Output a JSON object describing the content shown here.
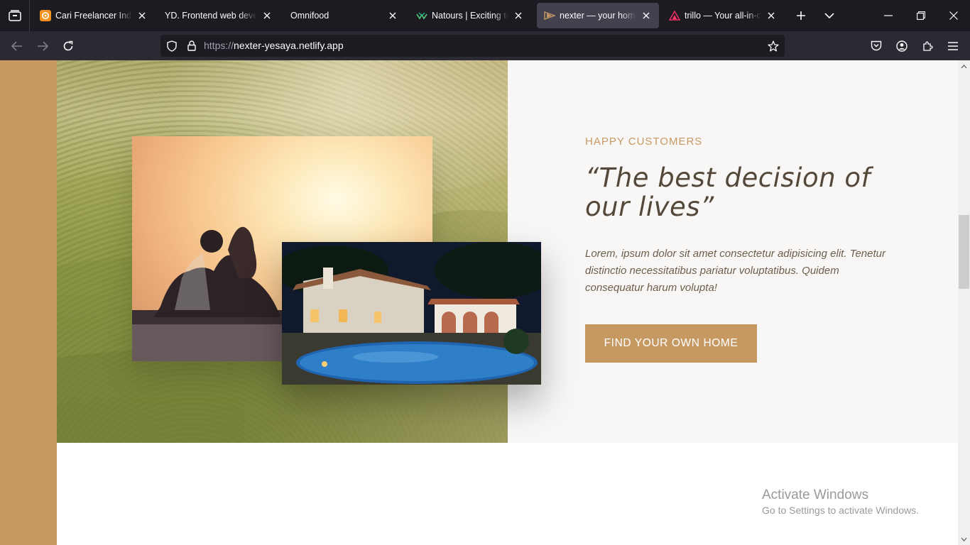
{
  "browser": {
    "tabs": [
      {
        "title": "Cari Freelancer Indonesia",
        "favicon": "orange-spiral-icon",
        "active": false
      },
      {
        "title": "YD. Frontend web developer",
        "favicon": "none",
        "active": false
      },
      {
        "title": "Omnifood",
        "favicon": "none",
        "active": false
      },
      {
        "title": "Natours | Exciting tours",
        "favicon": "natours-logo-icon",
        "active": false
      },
      {
        "title": "nexter — your home, your",
        "favicon": "nexter-logo-icon",
        "active": true
      },
      {
        "title": "trillo — Your all-in-one",
        "favicon": "trillo-logo-icon",
        "active": false
      }
    ],
    "url_scheme": "https://",
    "url_host": "nexter-yesaya.netlify.app",
    "colors": {
      "tabbar": "#1c1b22",
      "navbar": "#2b2a33",
      "active_tab": "#42414d"
    }
  },
  "page": {
    "section": {
      "eyebrow": "HAPPY CUSTOMERS",
      "quote": "“The best decision of our lives”",
      "body": "Lorem, ipsum dolor sit amet consectetur adipisicing elit. Tenetur distinctio necessitatibus pariatur voluptatibus. Quidem consequatur harum volupta!",
      "cta_label": "FIND YOUR OWN HOME"
    },
    "colors": {
      "accent": "#c69963",
      "quote": "#54483a",
      "panel_bg": "#f9f7f6"
    }
  },
  "os_overlay": {
    "title": "Activate Windows",
    "subtitle": "Go to Settings to activate Windows."
  }
}
